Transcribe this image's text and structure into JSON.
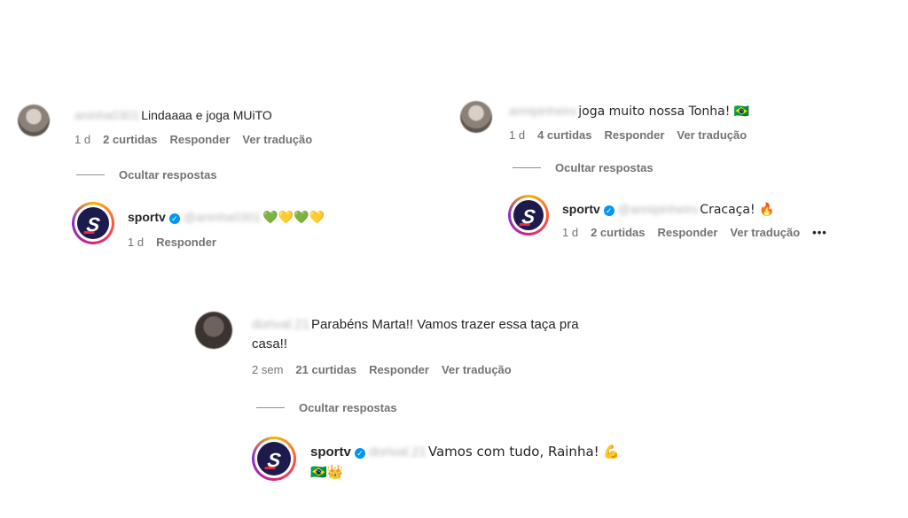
{
  "thread1": {
    "comment": {
      "user": "aninha0301",
      "text": "Lindaaaa e joga MUiTO",
      "time": "1 d",
      "likes": "2 curtidas",
      "reply": "Responder",
      "translate": "Ver tradução"
    },
    "hide_replies": "Ocultar respostas",
    "reply": {
      "user": "sportv",
      "mention": "@aninha0301",
      "text": "💚💛💚💛",
      "time": "1 d",
      "reply_label": "Responder"
    }
  },
  "thread2": {
    "comment": {
      "user": "annipinheiro",
      "text": "joga muito nossa Tonha! 🇧🇷",
      "time": "1 d",
      "likes": "4 curtidas",
      "reply": "Responder",
      "translate": "Ver tradução"
    },
    "hide_replies": "Ocultar respostas",
    "reply": {
      "user": "sportv",
      "mention": "@annipinheiro",
      "text": "Cracaça! 🔥",
      "time": "1 d",
      "likes": "2 curtidas",
      "reply_label": "Responder",
      "translate": "Ver tradução",
      "more": "•••"
    }
  },
  "thread3": {
    "comment": {
      "user": "dorival.21",
      "text_line1": "Parabéns Marta!! Vamos trazer essa taça pra",
      "text_line2": "casa!!",
      "time": "2 sem",
      "likes": "21 curtidas",
      "reply": "Responder",
      "translate": "Ver tradução"
    },
    "hide_replies": "Ocultar respostas",
    "reply": {
      "user": "sportv",
      "mention": "dorival.21",
      "text_line1": "Vamos com tudo, Rainha! 💪",
      "text_line2": "🇧🇷👑"
    }
  },
  "icons": {
    "verified": "verified-badge-icon",
    "logo": "sportv-logo",
    "logo_letter": "S"
  },
  "colors": {
    "verified": "#0095f6",
    "meta": "#737373",
    "logo_bg": "#1d1b4d"
  }
}
